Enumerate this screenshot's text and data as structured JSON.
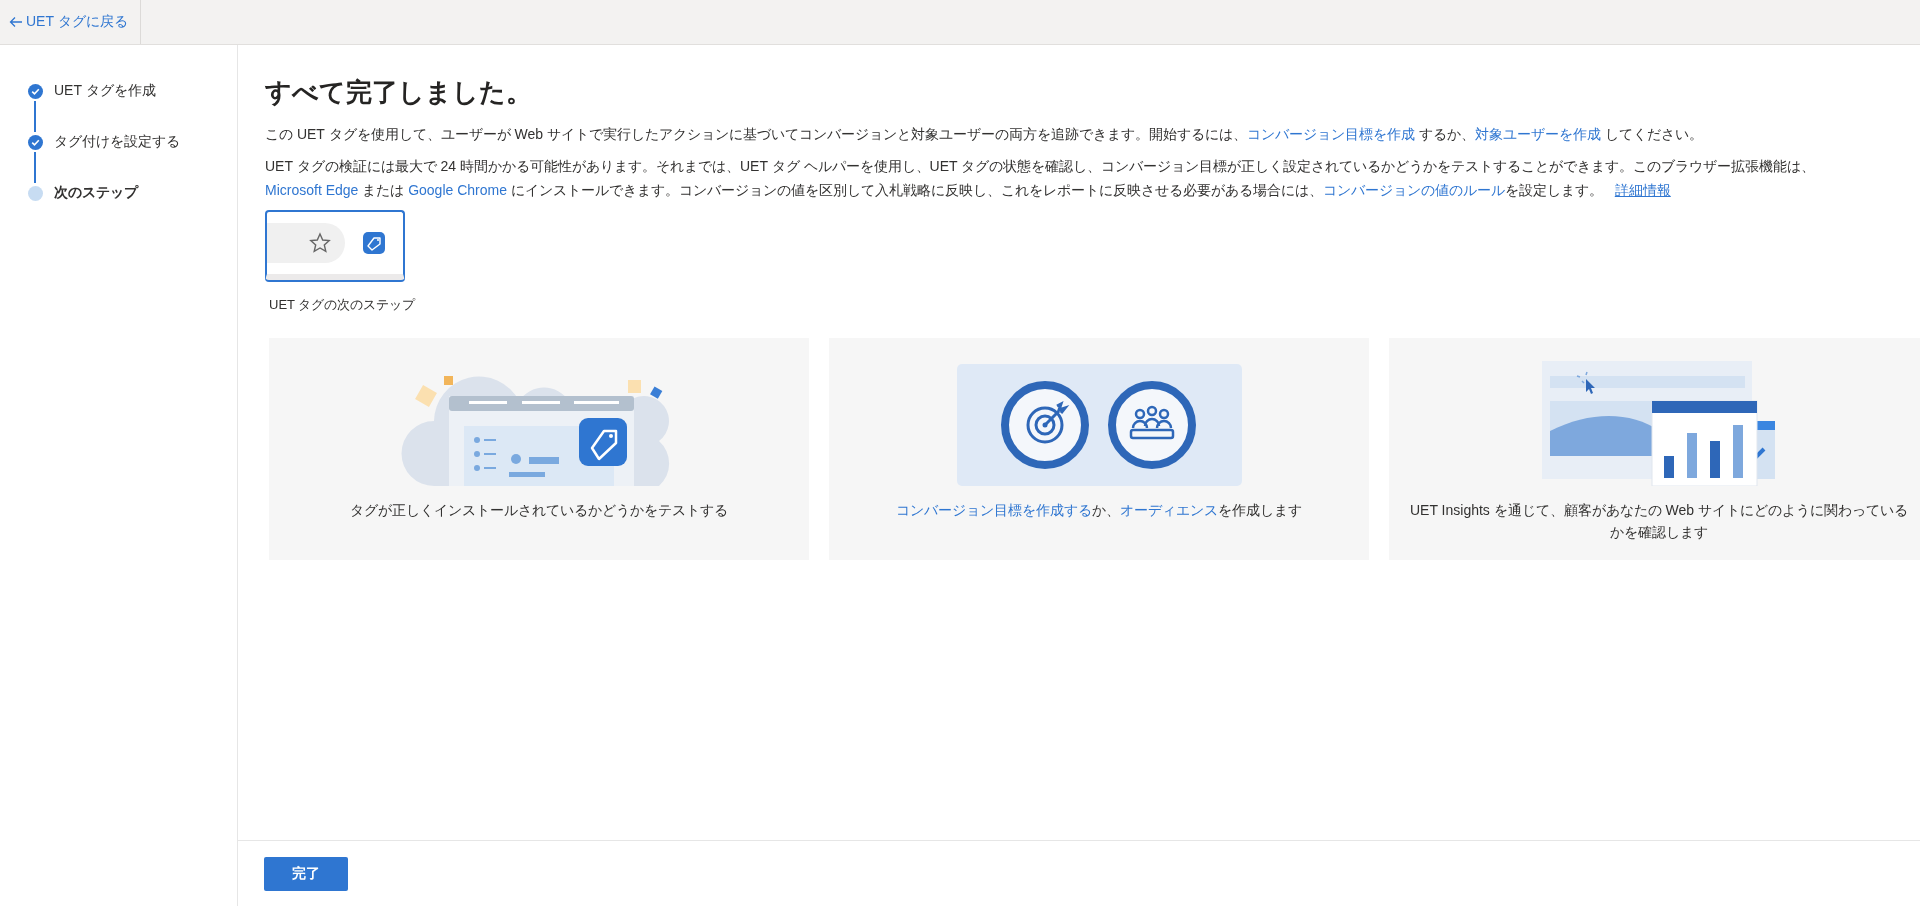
{
  "top_bar": {
    "back_link": "UET タグに戻る"
  },
  "steps": [
    {
      "label": "UET タグを作成",
      "completed": true,
      "selected": false
    },
    {
      "label": "タグ付けを設定する",
      "completed": true,
      "selected": false
    },
    {
      "label": "次のステップ",
      "completed": false,
      "selected": true
    }
  ],
  "heading": "すべて完了しました。",
  "paragraphs": [
    [
      {
        "kind": "text",
        "text": "この UET タグを使用して、ユーザーが Web サイトで実行したアクションに基づいてコンバージョンと対象ユーザーの両方を追跡できます。開始するには、"
      },
      {
        "kind": "link",
        "text": "コンバージョン目標を作成"
      },
      {
        "kind": "text",
        "text": " するか、"
      },
      {
        "kind": "link",
        "text": "対象ユーザーを作成"
      },
      {
        "kind": "text",
        "text": " してください。"
      }
    ],
    [
      {
        "kind": "text",
        "text": "UET タグの検証には最大で 24 時間かかる可能性があります。それまでは、UET タグ ヘルパーを使用し、UET タグの状態を確認し、コンバージョン目標が正しく設定されているかどうかをテストすることができます。このブラウザー拡張機能は、"
      },
      {
        "kind": "break"
      },
      {
        "kind": "link",
        "text": "Microsoft Edge"
      },
      {
        "kind": "text",
        "text": " または "
      },
      {
        "kind": "link",
        "text": "Google Chrome"
      },
      {
        "kind": "text",
        "text": " にインストールできます。コンバージョンの値を区別して入札戦略に反映し、これをレポートに反映させる必要がある場合には、"
      },
      {
        "kind": "link",
        "text": "コンバージョンの値のルール"
      },
      {
        "kind": "text",
        "text": "を設定します。 "
      },
      {
        "kind": "underlined-link",
        "text": "詳細情報"
      }
    ]
  ],
  "extension_preview": {
    "caption": "UET タグの次のステップ"
  },
  "cards": [
    {
      "kind": "install-test",
      "text": [
        {
          "kind": "text",
          "text": "タグが正しくインストールされているかどうかをテストする"
        }
      ]
    },
    {
      "kind": "goals-audience",
      "text": [
        {
          "kind": "link",
          "text": "コンバージョン目標を作成する"
        },
        {
          "kind": "text",
          "text": "か、"
        },
        {
          "kind": "link",
          "text": "オーディエンス"
        },
        {
          "kind": "text",
          "text": "を作成します"
        }
      ]
    },
    {
      "kind": "insights",
      "text": [
        {
          "kind": "text",
          "text": "UET Insights を通じて、顧客があなたの Web サイトにどのように関わっているかを確認します"
        }
      ]
    }
  ],
  "footer": {
    "button": "完了"
  }
}
